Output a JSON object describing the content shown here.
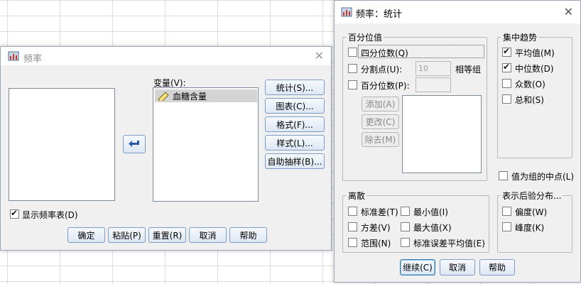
{
  "freq_dialog": {
    "title": "频率",
    "variables_label": "变量(V):",
    "variables": [
      "血糖含量"
    ],
    "side_buttons": [
      "统计(S)...",
      "图表(C)...",
      "格式(F)...",
      "样式(L)...",
      "自助抽样(B)..."
    ],
    "show_table_label": "显示频率表(D)",
    "show_table_checked": true,
    "bottom_buttons": [
      "确定",
      "粘贴(P)",
      "重置(R)",
      "取消",
      "帮助"
    ]
  },
  "stats_dialog": {
    "title": "频率：统计",
    "percentile_group": {
      "legend": "百分位值",
      "quartiles": "四分位数(Q)",
      "cutpoints": "分割点(U):",
      "cutpoints_value": "10",
      "equal_groups": "相等组",
      "percentiles": "百分位数(P):",
      "add": "添加(A)",
      "change": "更改(C)",
      "remove": "除去(M)"
    },
    "central_group": {
      "legend": "集中趋势",
      "items": [
        {
          "label": "平均值(M)",
          "checked": true
        },
        {
          "label": "中位数(D)",
          "checked": true
        },
        {
          "label": "众数(O)",
          "checked": false
        },
        {
          "label": "总和(S)",
          "checked": false
        }
      ]
    },
    "midpoint_label": "值为组的中点(L)",
    "dispersion_group": {
      "legend": "离散",
      "items": [
        "标准差(T)",
        "最小值(I)",
        "方差(V)",
        "最大值(X)",
        "范围(N)",
        "标准误差平均值(E)"
      ]
    },
    "distribution_group": {
      "legend": "表示后验分布...",
      "items": [
        "偏度(W)",
        "峰度(K)"
      ]
    },
    "buttons": [
      "继续(C)",
      "取消",
      "帮助"
    ]
  }
}
